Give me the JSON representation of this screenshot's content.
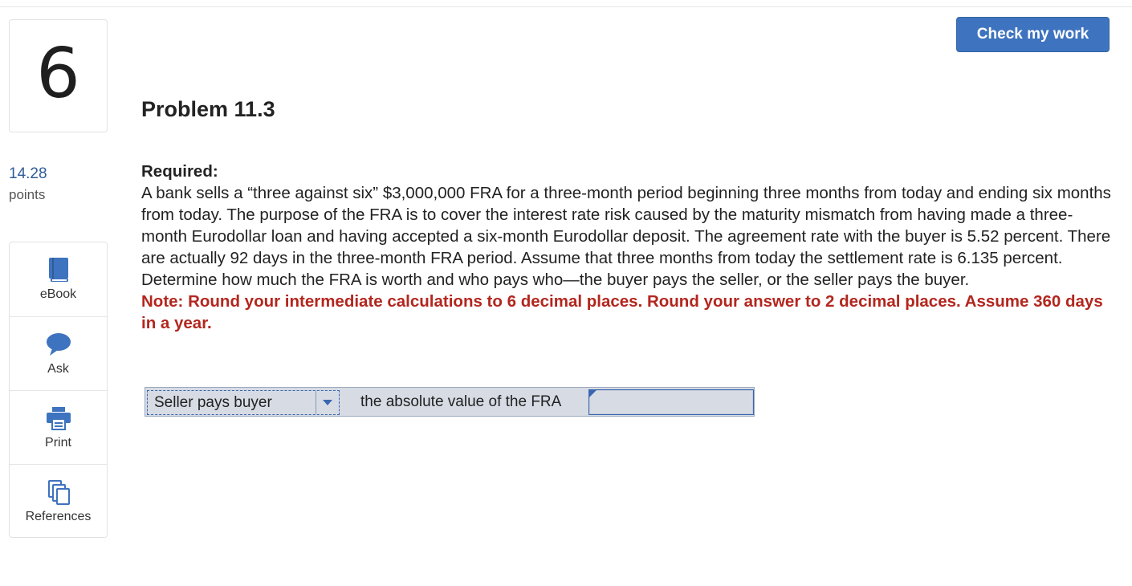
{
  "question": {
    "number": "6",
    "points_value": "14.28",
    "points_label": "points",
    "title": "Problem 11.3"
  },
  "header": {
    "check_label": "Check my work"
  },
  "tools": [
    {
      "label": "eBook",
      "icon": "book-icon"
    },
    {
      "label": "Ask",
      "icon": "chat-bubble-icon"
    },
    {
      "label": "Print",
      "icon": "printer-icon"
    },
    {
      "label": "References",
      "icon": "copy-pages-icon"
    }
  ],
  "problem": {
    "required_heading": "Required:",
    "body": "A bank sells a “three against six” $3,000,000 FRA for a three-month period beginning three months from today and ending six months from today. The purpose of the FRA is to cover the interest rate risk caused by the maturity mismatch from having made a three-month Eurodollar loan and having accepted a six-month Eurodollar deposit. The agreement rate with the buyer is 5.52 percent. There are actually 92 days in the three-month FRA period. Assume that three months from today the settlement rate is 6.135 percent. Determine how much the FRA is worth and who pays who—the buyer pays the seller, or the seller pays the buyer.",
    "note": "Note: Round your intermediate calculations to 6 decimal places. Round your answer to 2 decimal places. Assume 360 days in a year."
  },
  "answer": {
    "select_value": "Seller pays buyer",
    "between_text": "the absolute value of the FRA",
    "input_value": ""
  },
  "colors": {
    "accent": "#3e73bf",
    "note_red": "#b3261e",
    "answer_bg": "#d6dbe4"
  }
}
